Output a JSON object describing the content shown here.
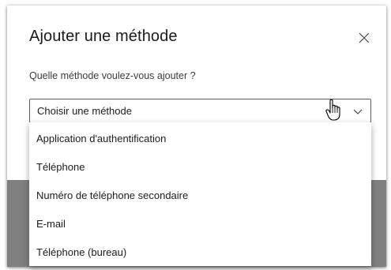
{
  "dialog": {
    "title": "Ajouter une méthode",
    "subtitle": "Quelle méthode voulez-vous ajouter ?",
    "close_icon": "close-icon"
  },
  "select": {
    "value": "Choisir une méthode",
    "chevron_icon": "chevron-down-icon",
    "options": [
      "Application d'authentification",
      "Téléphone",
      "Numéro de téléphone secondaire",
      "E-mail",
      "Téléphone (bureau)"
    ]
  },
  "colors": {
    "backdrop": "#808080",
    "text": "#1b1b1b",
    "border": "#605e5c"
  }
}
